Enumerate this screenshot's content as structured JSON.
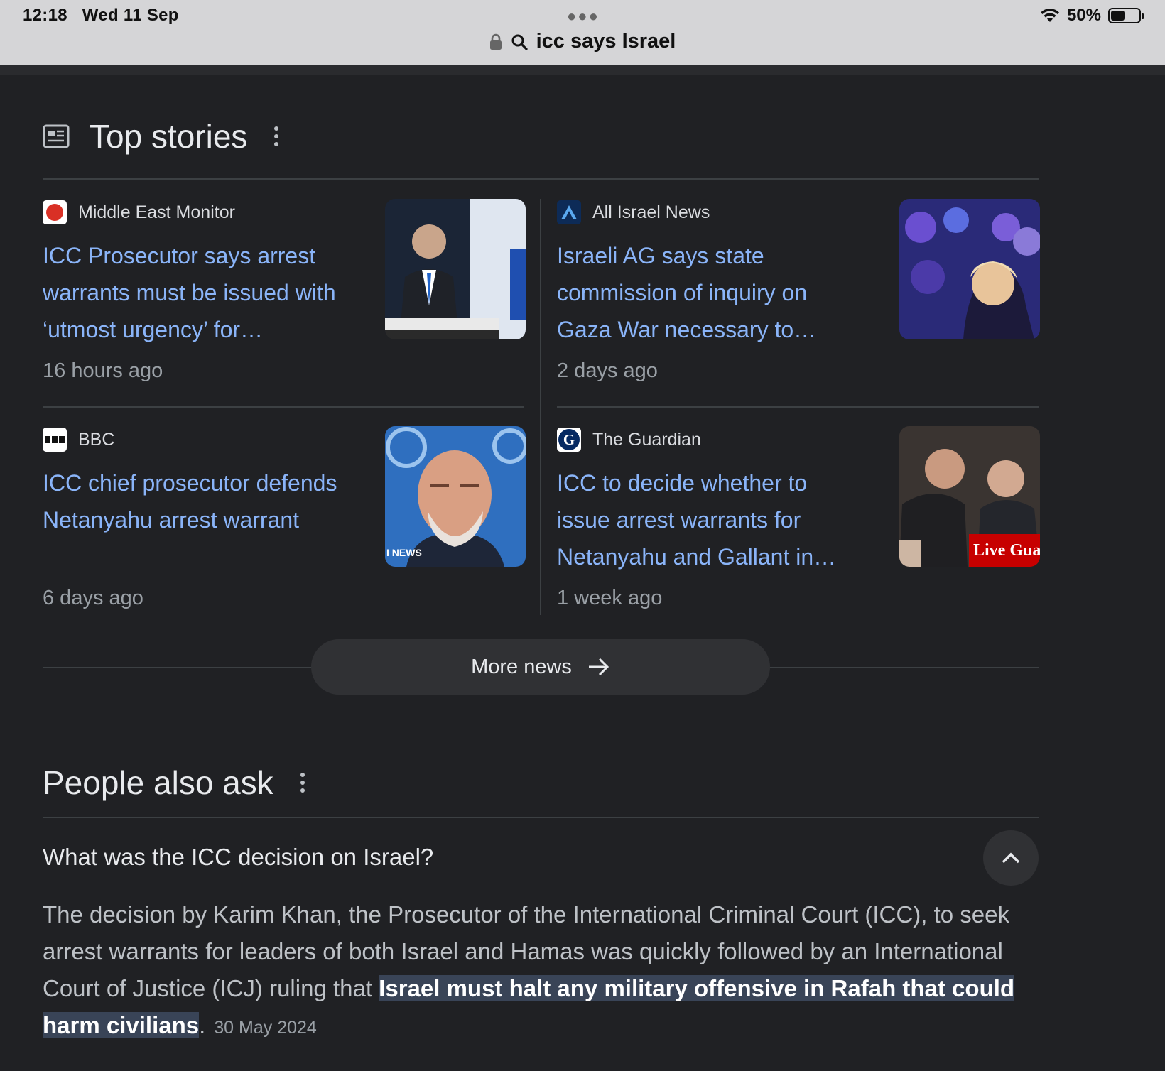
{
  "status_bar": {
    "time": "12:18",
    "date": "Wed 11 Sep",
    "battery_text": "50%",
    "battery_level": 0.5
  },
  "address_bar": {
    "query": "icc says Israel"
  },
  "top_stories": {
    "title": "Top stories",
    "stories": [
      {
        "source": "Middle East Monitor",
        "headline": "ICC Prosecutor says arrest warrants must be issued with ‘utmost urgency’ for…",
        "time": "16 hours ago"
      },
      {
        "source": "All Israel News",
        "headline": "Israeli AG says state commission of inquiry on Gaza War necessary to…",
        "time": "2 days ago"
      },
      {
        "source": "BBC",
        "headline": "ICC chief prosecutor defends Netanyahu arrest warrant",
        "time": "6 days ago"
      },
      {
        "source": "The Guardian",
        "headline": "ICC to decide whether to issue arrest warrants for Netanyahu and Gallant in…",
        "time": "1 week ago"
      }
    ],
    "thumb_overlays": {
      "bbc": "I NEWS",
      "guardian": "Live Gua"
    },
    "more_label": "More news"
  },
  "people_also_ask": {
    "title": "People also ask",
    "question": "What was the ICC decision on Israel?",
    "answer_prefix": "The decision by Karim Khan, the Prosecutor of the International Criminal Court (ICC), to seek arrest warrants for leaders of both Israel and Hamas was quickly followed by an International Court of Justice (ICJ) ruling that ",
    "answer_highlight": "Israel must halt any military offensive in Rafah that could harm civilians",
    "answer_suffix": ".",
    "answer_date": "30 May 2024"
  },
  "colors": {
    "background": "#202124",
    "link": "#8ab4f8",
    "highlight": "#394457",
    "mem_red": "#d93025",
    "ain_blue": "#1a73e8"
  }
}
